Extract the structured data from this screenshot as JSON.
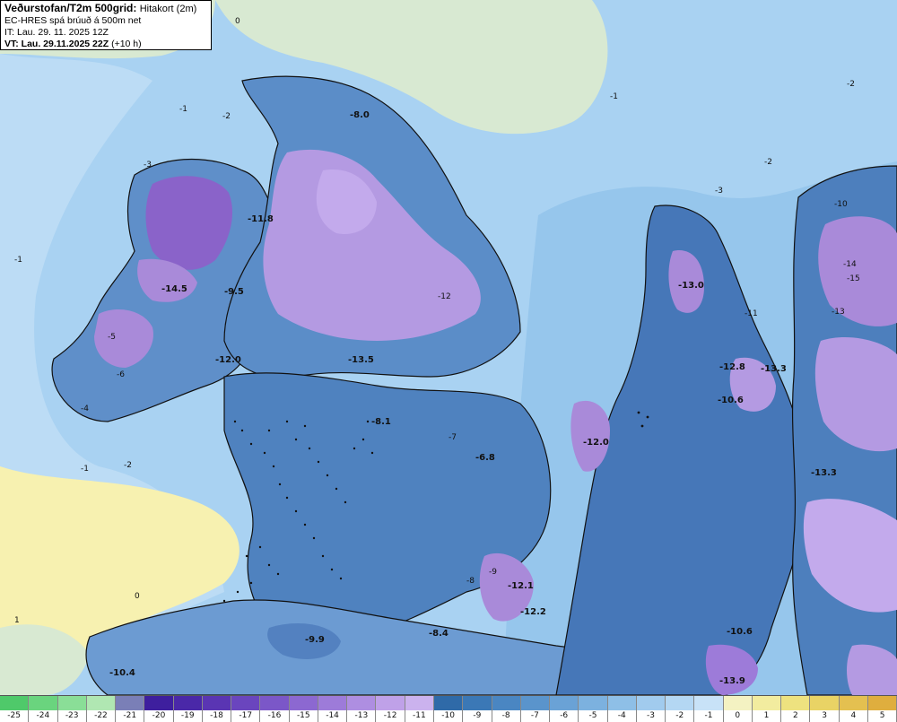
{
  "header": {
    "title_bold": "Veðurstofan/T2m 500grid:",
    "title_sub": "Hitakort (2m)",
    "model_line": "EC-HRES spá brúuð á 500m net",
    "init_line": "IT: Lau. 29. 11. 2025 12Z",
    "valid_bold": "VT: Lau. 29.11.2025 22Z",
    "lead_time": "(+10 h)"
  },
  "colors": {
    "sea_light": "#a9d2f2",
    "sea_mid": "#8fbfe9",
    "land_warm_green": "#d8e9d2",
    "land_warm_yellow": "#f7f1b0",
    "coast_line": "#111111"
  },
  "colorbar": {
    "levels": [
      {
        "label": "-25",
        "color": "#4fc96a"
      },
      {
        "label": "-24",
        "color": "#6ad47e"
      },
      {
        "label": "-23",
        "color": "#8ade97"
      },
      {
        "label": "-22",
        "color": "#b0e7b2"
      },
      {
        "label": "-21",
        "color": "#7a7fb7"
      },
      {
        "label": "-20",
        "color": "#3e1f9e"
      },
      {
        "label": "-19",
        "color": "#4a28a8"
      },
      {
        "label": "-18",
        "color": "#5a35b3"
      },
      {
        "label": "-17",
        "color": "#6a45be"
      },
      {
        "label": "-16",
        "color": "#7b57c8"
      },
      {
        "label": "-15",
        "color": "#8c68d1"
      },
      {
        "label": "-14",
        "color": "#9d7bd9"
      },
      {
        "label": "-13",
        "color": "#ae8ee1"
      },
      {
        "label": "-12",
        "color": "#bfa1e8"
      },
      {
        "label": "-11",
        "color": "#cbb2ee"
      },
      {
        "label": "-10",
        "color": "#2f6aa8"
      },
      {
        "label": "-9",
        "color": "#3b78b6"
      },
      {
        "label": "-8",
        "color": "#4a86c2"
      },
      {
        "label": "-7",
        "color": "#5a94cc"
      },
      {
        "label": "-6",
        "color": "#6aa2d6"
      },
      {
        "label": "-5",
        "color": "#7cb1df"
      },
      {
        "label": "-4",
        "color": "#8ebfe7"
      },
      {
        "label": "-3",
        "color": "#a1cbee"
      },
      {
        "label": "-2",
        "color": "#b4d7f3"
      },
      {
        "label": "-1",
        "color": "#c8e2f7"
      },
      {
        "label": "0",
        "color": "#f4f2c2"
      },
      {
        "label": "1",
        "color": "#f2ec9f"
      },
      {
        "label": "2",
        "color": "#eee27f"
      },
      {
        "label": "3",
        "color": "#e9d365"
      },
      {
        "label": "4",
        "color": "#e4c050"
      },
      {
        "label": "5",
        "color": "#dfae3e"
      }
    ]
  },
  "map_labels": {
    "extremes": [
      "-8.0",
      "-14.5",
      "-9.5",
      "-12.0",
      "-13.5",
      "-8.1",
      "-6.8",
      "-12.0",
      "-13.0",
      "-12.8",
      "-13.3",
      "-10.6",
      "-13.3",
      "-12.1",
      "-12.2",
      "-9.9",
      "-8.4",
      "-10.4",
      "-10.6",
      "-13.9",
      "-11.8"
    ],
    "contours": [
      "0",
      "-1",
      "-2",
      "-3",
      "-2",
      "-1",
      "-2",
      "-1",
      "0",
      "1",
      "-1",
      "-2",
      "-3",
      "-4",
      "-5",
      "-6",
      "-7",
      "-8",
      "-9",
      "-10",
      "-11",
      "-12",
      "-13",
      "-14",
      "-15"
    ]
  }
}
